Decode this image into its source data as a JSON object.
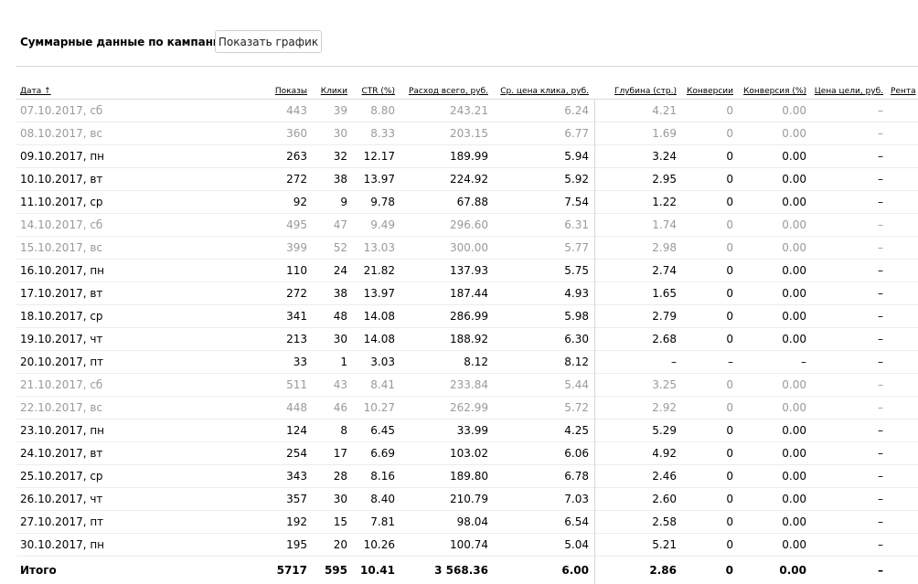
{
  "header": {
    "title": "Суммарные данные по кампании",
    "chart_button": "Показать график"
  },
  "columns": [
    {
      "key": "date",
      "label": "Дата ↑"
    },
    {
      "key": "shows",
      "label": "Показы"
    },
    {
      "key": "clicks",
      "label": "Клики"
    },
    {
      "key": "ctr",
      "label": "CTR (%)"
    },
    {
      "key": "spend",
      "label": "Расход всего, руб."
    },
    {
      "key": "cpc",
      "label": "Ср. цена клика, руб."
    },
    {
      "key": "depth",
      "label": "Глубина (стр.)"
    },
    {
      "key": "conv",
      "label": "Конверсии"
    },
    {
      "key": "convrate",
      "label": "Конверсия (%)"
    },
    {
      "key": "goalcost",
      "label": "Цена цели, руб."
    },
    {
      "key": "profit",
      "label": "Рента"
    }
  ],
  "rows": [
    {
      "date": "07.10.2017, сб",
      "weekend": true,
      "shows": "443",
      "clicks": "39",
      "ctr": "8.80",
      "spend": "243.21",
      "cpc": "6.24",
      "depth": "4.21",
      "conv": "0",
      "convrate": "0.00",
      "goalcost": "–"
    },
    {
      "date": "08.10.2017, вс",
      "weekend": true,
      "shows": "360",
      "clicks": "30",
      "ctr": "8.33",
      "spend": "203.15",
      "cpc": "6.77",
      "depth": "1.69",
      "conv": "0",
      "convrate": "0.00",
      "goalcost": "–"
    },
    {
      "date": "09.10.2017, пн",
      "weekend": false,
      "shows": "263",
      "clicks": "32",
      "ctr": "12.17",
      "spend": "189.99",
      "cpc": "5.94",
      "depth": "3.24",
      "conv": "0",
      "convrate": "0.00",
      "goalcost": "–"
    },
    {
      "date": "10.10.2017, вт",
      "weekend": false,
      "shows": "272",
      "clicks": "38",
      "ctr": "13.97",
      "spend": "224.92",
      "cpc": "5.92",
      "depth": "2.95",
      "conv": "0",
      "convrate": "0.00",
      "goalcost": "–"
    },
    {
      "date": "11.10.2017, ср",
      "weekend": false,
      "shows": "92",
      "clicks": "9",
      "ctr": "9.78",
      "spend": "67.88",
      "cpc": "7.54",
      "depth": "1.22",
      "conv": "0",
      "convrate": "0.00",
      "goalcost": "–"
    },
    {
      "date": "14.10.2017, сб",
      "weekend": true,
      "shows": "495",
      "clicks": "47",
      "ctr": "9.49",
      "spend": "296.60",
      "cpc": "6.31",
      "depth": "1.74",
      "conv": "0",
      "convrate": "0.00",
      "goalcost": "–"
    },
    {
      "date": "15.10.2017, вс",
      "weekend": true,
      "shows": "399",
      "clicks": "52",
      "ctr": "13.03",
      "spend": "300.00",
      "cpc": "5.77",
      "depth": "2.98",
      "conv": "0",
      "convrate": "0.00",
      "goalcost": "–"
    },
    {
      "date": "16.10.2017, пн",
      "weekend": false,
      "shows": "110",
      "clicks": "24",
      "ctr": "21.82",
      "spend": "137.93",
      "cpc": "5.75",
      "depth": "2.74",
      "conv": "0",
      "convrate": "0.00",
      "goalcost": "–"
    },
    {
      "date": "17.10.2017, вт",
      "weekend": false,
      "shows": "272",
      "clicks": "38",
      "ctr": "13.97",
      "spend": "187.44",
      "cpc": "4.93",
      "depth": "1.65",
      "conv": "0",
      "convrate": "0.00",
      "goalcost": "–"
    },
    {
      "date": "18.10.2017, ср",
      "weekend": false,
      "shows": "341",
      "clicks": "48",
      "ctr": "14.08",
      "spend": "286.99",
      "cpc": "5.98",
      "depth": "2.79",
      "conv": "0",
      "convrate": "0.00",
      "goalcost": "–"
    },
    {
      "date": "19.10.2017, чт",
      "weekend": false,
      "shows": "213",
      "clicks": "30",
      "ctr": "14.08",
      "spend": "188.92",
      "cpc": "6.30",
      "depth": "2.68",
      "conv": "0",
      "convrate": "0.00",
      "goalcost": "–"
    },
    {
      "date": "20.10.2017, пт",
      "weekend": false,
      "shows": "33",
      "clicks": "1",
      "ctr": "3.03",
      "spend": "8.12",
      "cpc": "8.12",
      "depth": "–",
      "conv": "–",
      "convrate": "–",
      "goalcost": "–"
    },
    {
      "date": "21.10.2017, сб",
      "weekend": true,
      "shows": "511",
      "clicks": "43",
      "ctr": "8.41",
      "spend": "233.84",
      "cpc": "5.44",
      "depth": "3.25",
      "conv": "0",
      "convrate": "0.00",
      "goalcost": "–"
    },
    {
      "date": "22.10.2017, вс",
      "weekend": true,
      "shows": "448",
      "clicks": "46",
      "ctr": "10.27",
      "spend": "262.99",
      "cpc": "5.72",
      "depth": "2.92",
      "conv": "0",
      "convrate": "0.00",
      "goalcost": "–"
    },
    {
      "date": "23.10.2017, пн",
      "weekend": false,
      "shows": "124",
      "clicks": "8",
      "ctr": "6.45",
      "spend": "33.99",
      "cpc": "4.25",
      "depth": "5.29",
      "conv": "0",
      "convrate": "0.00",
      "goalcost": "–"
    },
    {
      "date": "24.10.2017, вт",
      "weekend": false,
      "shows": "254",
      "clicks": "17",
      "ctr": "6.69",
      "spend": "103.02",
      "cpc": "6.06",
      "depth": "4.92",
      "conv": "0",
      "convrate": "0.00",
      "goalcost": "–"
    },
    {
      "date": "25.10.2017, ср",
      "weekend": false,
      "shows": "343",
      "clicks": "28",
      "ctr": "8.16",
      "spend": "189.80",
      "cpc": "6.78",
      "depth": "2.46",
      "conv": "0",
      "convrate": "0.00",
      "goalcost": "–"
    },
    {
      "date": "26.10.2017, чт",
      "weekend": false,
      "shows": "357",
      "clicks": "30",
      "ctr": "8.40",
      "spend": "210.79",
      "cpc": "7.03",
      "depth": "2.60",
      "conv": "0",
      "convrate": "0.00",
      "goalcost": "–"
    },
    {
      "date": "27.10.2017, пт",
      "weekend": false,
      "shows": "192",
      "clicks": "15",
      "ctr": "7.81",
      "spend": "98.04",
      "cpc": "6.54",
      "depth": "2.58",
      "conv": "0",
      "convrate": "0.00",
      "goalcost": "–"
    },
    {
      "date": "30.10.2017, пн",
      "weekend": false,
      "shows": "195",
      "clicks": "20",
      "ctr": "10.26",
      "spend": "100.74",
      "cpc": "5.04",
      "depth": "5.21",
      "conv": "0",
      "convrate": "0.00",
      "goalcost": "–"
    }
  ],
  "total": {
    "date": "Итого",
    "shows": "5717",
    "clicks": "595",
    "ctr": "10.41",
    "spend": "3 568.36",
    "cpc": "6.00",
    "depth": "2.86",
    "conv": "0",
    "convrate": "0.00",
    "goalcost": "–"
  },
  "colors": {
    "weekend_text": "#9a9a9a",
    "border": "#d9d9d9"
  }
}
